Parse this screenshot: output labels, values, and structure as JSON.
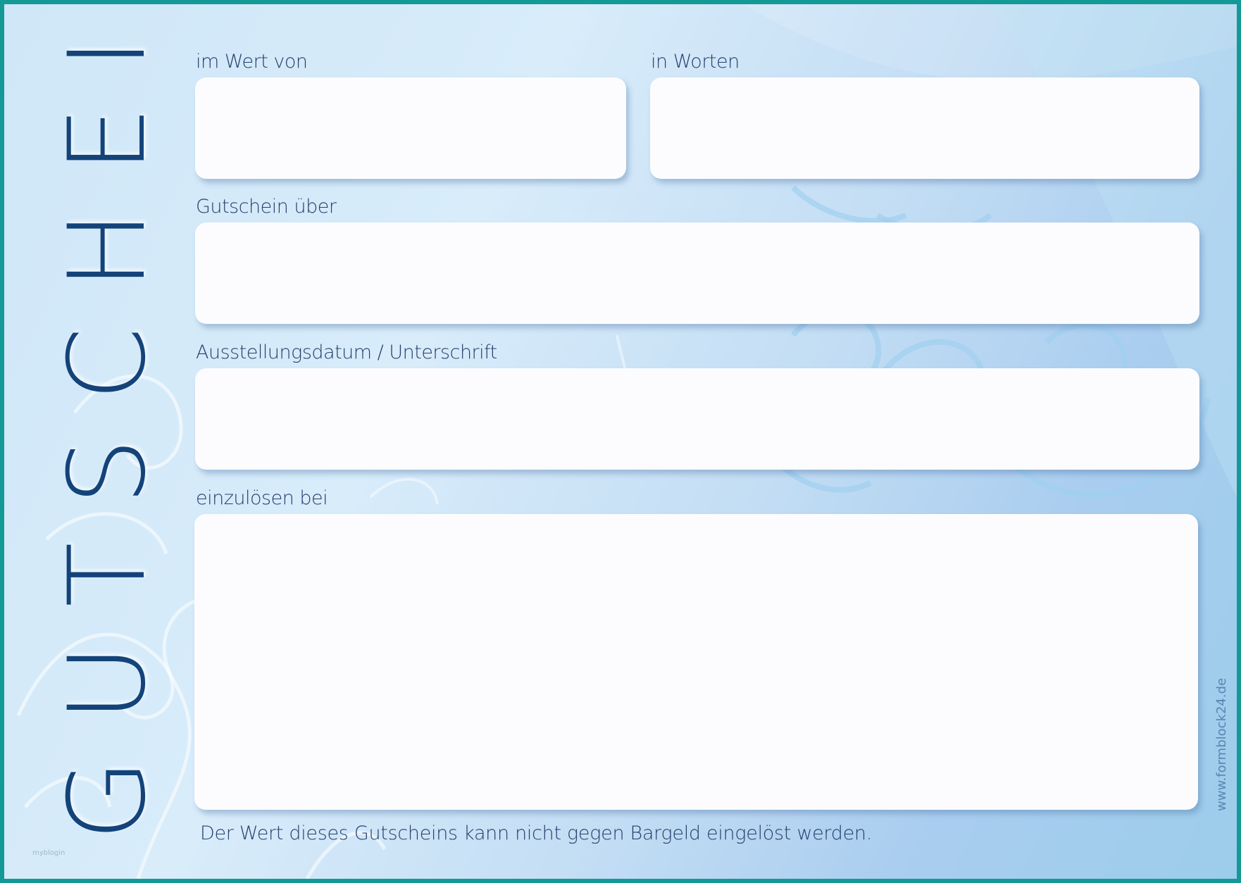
{
  "title": "GUTSCHEIN",
  "fields": {
    "value": {
      "label": "im Wert von",
      "value": ""
    },
    "in_words": {
      "label": "in Worten",
      "value": ""
    },
    "voucher_for": {
      "label": "Gutschein über",
      "value": ""
    },
    "issue_date_signature": {
      "label": "Ausstellungsdatum / Unterschrift",
      "value": ""
    },
    "redeemable_at": {
      "label": "einzulösen bei",
      "value": ""
    }
  },
  "disclaimer": "Der Wert dieses Gutscheins kann nicht gegen Bargeld eingelöst werden.",
  "website": "www.formblock24.de",
  "watermark": "myblogin",
  "colors": {
    "border": "#139a96",
    "title": "#14437a",
    "label": "#26406c",
    "box": "#fcfcff"
  }
}
